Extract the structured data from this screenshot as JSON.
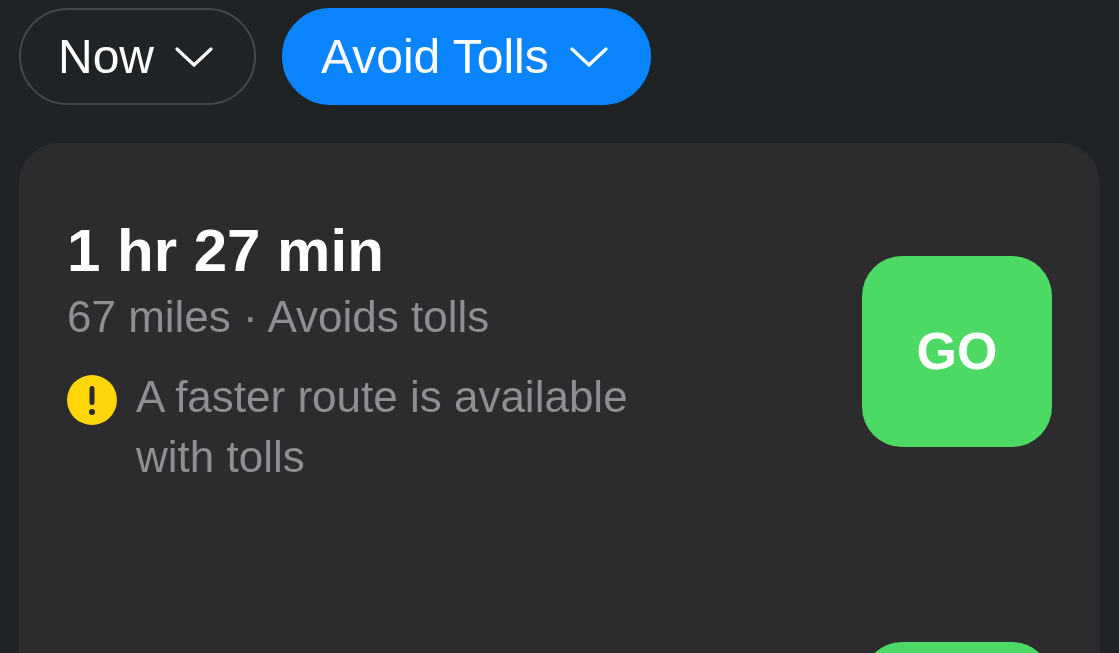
{
  "filters": [
    {
      "label": "Now",
      "selected": false
    },
    {
      "label": "Avoid Tolls",
      "selected": true
    }
  ],
  "routes": [
    {
      "duration": "1 hr 27 min",
      "details": "67 miles · Avoids tolls",
      "warning": "A faster route is available with tolls",
      "action": "GO"
    }
  ]
}
